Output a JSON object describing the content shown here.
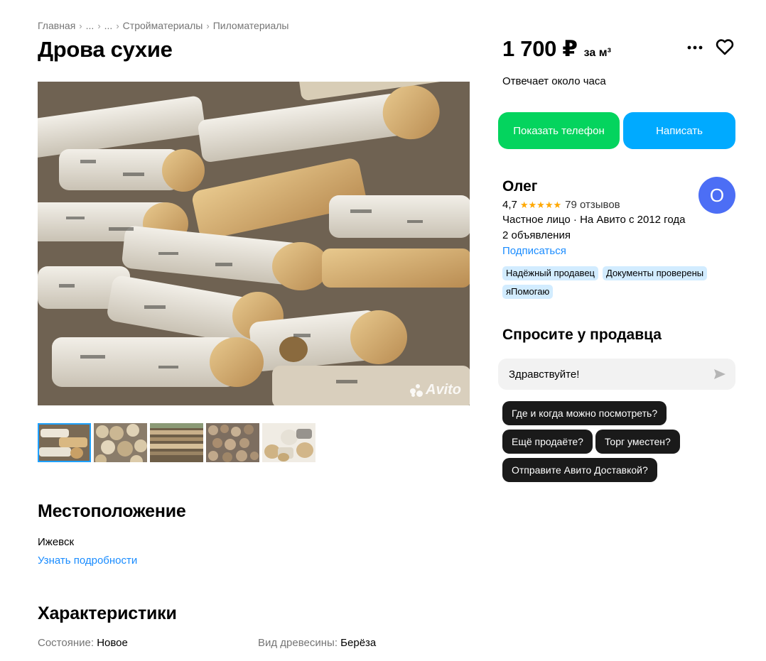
{
  "breadcrumb": {
    "items": [
      "Главная",
      "...",
      "...",
      "Стройматериалы",
      "Пиломатериалы"
    ],
    "separator": "›"
  },
  "listing": {
    "title": "Дрова сухие",
    "price": "1 700 ₽",
    "price_unit": "за м³",
    "reply_time": "Отвечает около часа"
  },
  "gallery": {
    "watermark": "Avito",
    "thumbnails_count": 5,
    "active_index": 0
  },
  "actions": {
    "show_phone": "Показать телефон",
    "write": "Написать",
    "more_icon": "more-dots-icon",
    "favorite_icon": "heart-icon"
  },
  "seller": {
    "name": "Олег",
    "rating": "4,7",
    "stars": "★★★★★",
    "reviews": "79 отзывов",
    "type": "Частное лицо · На Авито с 2012 года",
    "ads": "2 объявления",
    "subscribe": "Подписаться",
    "avatar_letter": "О",
    "avatar_color": "#4c6ef5",
    "badges": [
      "Надёжный продавец",
      "Документы проверены",
      "яПомогаю"
    ]
  },
  "ask": {
    "title": "Спросите у продавца",
    "input_value": "Здравствуйте!",
    "chips": [
      "Где и когда можно посмотреть?",
      "Ещё продаёте?",
      "Торг уместен?",
      "Отправите Авито Доставкой?"
    ]
  },
  "location": {
    "title": "Местоположение",
    "city": "Ижевск",
    "more": "Узнать подробности"
  },
  "characteristics": {
    "title": "Характеристики",
    "rows": [
      [
        {
          "key": "Состояние:",
          "value": "Новое"
        },
        {
          "key": "Вид древесины:",
          "value": "Берёза"
        }
      ]
    ]
  },
  "colors": {
    "green": "#04d45e",
    "blue": "#00aaff",
    "link": "#1a8cff",
    "badge": "#d2ecff",
    "chip": "#1a1a1a"
  }
}
